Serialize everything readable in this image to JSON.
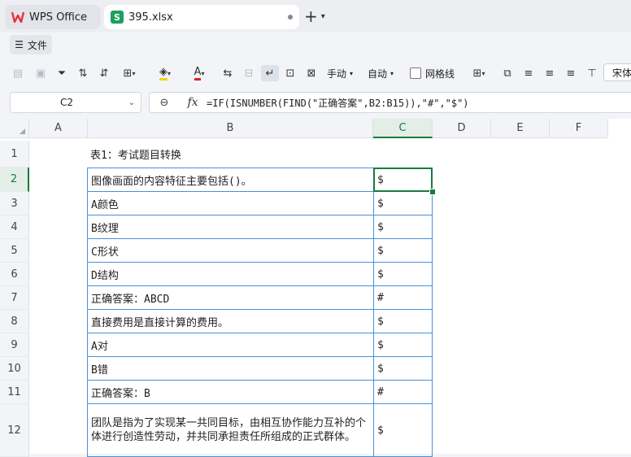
{
  "tabs": {
    "home_label": "WPS Office",
    "file_label": "395.xlsx",
    "new_tab": "+"
  },
  "menu": {
    "file_label": "文件"
  },
  "toolbar": {
    "manual_label": "手动",
    "auto_label": "自动",
    "gridlines_label": "网格线",
    "font_name": "宋体"
  },
  "formula_bar": {
    "cell_ref": "C2",
    "fx_label": "fx",
    "formula": "=IF(ISNUMBER(FIND(\"正确答案\",B2:B15)),\"#\",\"$\")"
  },
  "columns": [
    "A",
    "B",
    "C",
    "D",
    "E",
    "F"
  ],
  "rows": [
    {
      "num": "1",
      "b": "表1：考试题目转换",
      "c": ""
    },
    {
      "num": "2",
      "b": "图像画面的内容特征主要包括()。",
      "c": "$"
    },
    {
      "num": "3",
      "b": "A颜色",
      "c": "$"
    },
    {
      "num": "4",
      "b": "B纹理",
      "c": "$"
    },
    {
      "num": "5",
      "b": "C形状",
      "c": "$"
    },
    {
      "num": "6",
      "b": "D结构",
      "c": "$"
    },
    {
      "num": "7",
      "b": "正确答案：ABCD",
      "c": "#"
    },
    {
      "num": "8",
      "b": "直接费用是直接计算的费用。",
      "c": "$"
    },
    {
      "num": "9",
      "b": "A对",
      "c": "$"
    },
    {
      "num": "10",
      "b": "B错",
      "c": "$"
    },
    {
      "num": "11",
      "b": "正确答案：B",
      "c": "#"
    },
    {
      "num": "12",
      "b": "团队是指为了实现某一共同目标，由相互协作能力互补的个体进行创造性劳动，并共同承担责任所组成的正式群体。",
      "c": "$"
    }
  ],
  "colors": {
    "accent": "#1b7a3d",
    "table_border": "#4a90d9",
    "wps_red": "#e8303a"
  }
}
